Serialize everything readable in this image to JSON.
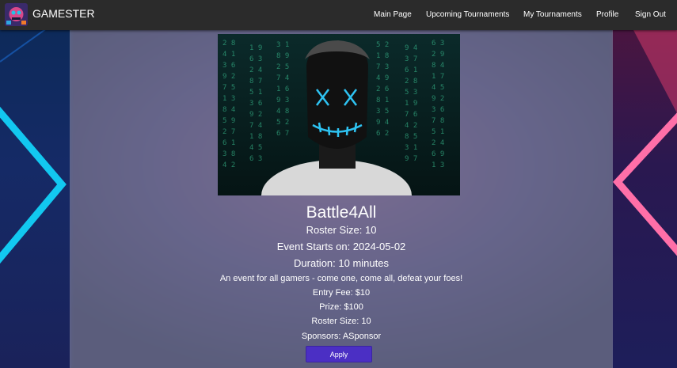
{
  "navbar": {
    "brand": "GAMESTER",
    "links": {
      "main": "Main Page",
      "upcoming": "Upcoming Tournaments",
      "mine": "My Tournaments",
      "profile": "Profile",
      "signout": "Sign Out"
    }
  },
  "event": {
    "title": "Battle4All",
    "roster_line": "Roster Size: 10",
    "start_line": "Event Starts on: 2024-05-02",
    "duration_line": "Duration: 10 minutes",
    "description": "An event for all gamers - come one, come all, defeat your foes!",
    "fee_line": "Entry Fee: $10",
    "prize_line": "Prize: $100",
    "roster_line_2": "Roster Size: 10",
    "sponsors_line": "Sponsors: ASponsor",
    "apply_label": "Apply"
  },
  "colors": {
    "navbar": "#2b2b2b",
    "apply_button": "#4b2fc4",
    "neon_cyan": "#12c8f0",
    "neon_pink": "#ff6fa8"
  }
}
